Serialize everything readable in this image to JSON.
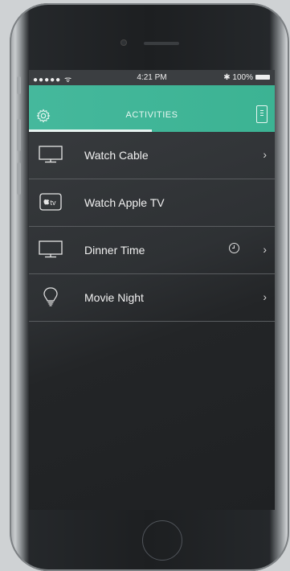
{
  "status": {
    "carrier": "●●●●● ᯤ",
    "time": "4:21 PM",
    "battery": "100%"
  },
  "header": {
    "title": "ACTIVITIES"
  },
  "activities": [
    {
      "label": "Watch Cable"
    },
    {
      "label": "Watch Apple TV",
      "badge": "tv"
    },
    {
      "label": "Dinner Time"
    },
    {
      "label": "Movie Night"
    }
  ],
  "icons": {
    "chevron": "›"
  },
  "colors": {
    "accent": "#45b89c"
  }
}
